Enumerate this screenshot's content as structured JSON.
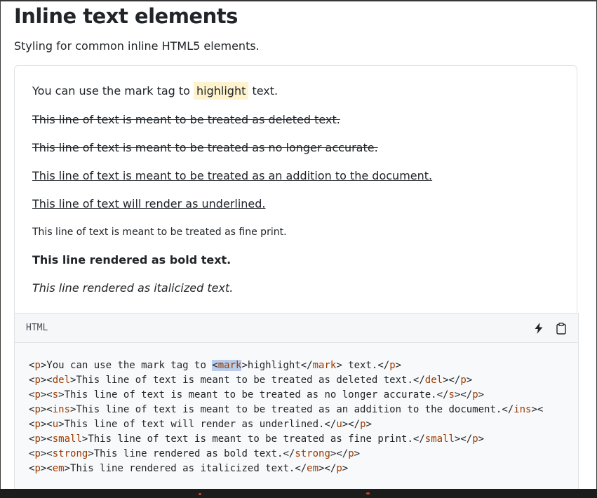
{
  "page": {
    "title": "Inline text elements",
    "subtitle": "Styling for common inline HTML5 elements."
  },
  "example": {
    "mark_before": "You can use the mark tag to ",
    "mark_text": "highlight",
    "mark_after": " text.",
    "del": "This line of text is meant to be treated as deleted text.",
    "s": "This line of text is meant to be treated as no longer accurate.",
    "ins": "This line of text is meant to be treated as an addition to the document.",
    "u": "This line of text will render as underlined.",
    "small": "This line of text is meant to be treated as fine print.",
    "strong": "This line rendered as bold text.",
    "em": "This line rendered as italicized text."
  },
  "code": {
    "language": "HTML",
    "icons": {
      "run": "lightning-icon",
      "copy": "clipboard-icon"
    },
    "lines": [
      [
        {
          "t": "<"
        },
        {
          "t": "p",
          "tag": 1
        },
        {
          "t": ">You can use the mark tag to "
        },
        {
          "t": "<mark",
          "sel": 1
        },
        {
          "t": ">highlight</"
        },
        {
          "t": "mark",
          "tag": 1
        },
        {
          "t": "> text.</"
        },
        {
          "t": "p",
          "tag": 1
        },
        {
          "t": ">"
        }
      ],
      [
        {
          "t": "<"
        },
        {
          "t": "p",
          "tag": 1
        },
        {
          "t": "><"
        },
        {
          "t": "del",
          "tag": 1
        },
        {
          "t": ">This line of text is meant to be treated as deleted text.</"
        },
        {
          "t": "del",
          "tag": 1
        },
        {
          "t": "></"
        },
        {
          "t": "p",
          "tag": 1
        },
        {
          "t": ">"
        }
      ],
      [
        {
          "t": "<"
        },
        {
          "t": "p",
          "tag": 1
        },
        {
          "t": "><"
        },
        {
          "t": "s",
          "tag": 1
        },
        {
          "t": ">This line of text is meant to be treated as no longer accurate.</"
        },
        {
          "t": "s",
          "tag": 1
        },
        {
          "t": "></"
        },
        {
          "t": "p",
          "tag": 1
        },
        {
          "t": ">"
        }
      ],
      [
        {
          "t": "<"
        },
        {
          "t": "p",
          "tag": 1
        },
        {
          "t": "><"
        },
        {
          "t": "ins",
          "tag": 1
        },
        {
          "t": ">This line of text is meant to be treated as an addition to the document.</"
        },
        {
          "t": "ins",
          "tag": 1
        },
        {
          "t": "><"
        }
      ],
      [
        {
          "t": "<"
        },
        {
          "t": "p",
          "tag": 1
        },
        {
          "t": "><"
        },
        {
          "t": "u",
          "tag": 1
        },
        {
          "t": ">This line of text will render as underlined.</"
        },
        {
          "t": "u",
          "tag": 1
        },
        {
          "t": "></"
        },
        {
          "t": "p",
          "tag": 1
        },
        {
          "t": ">"
        }
      ],
      [
        {
          "t": "<"
        },
        {
          "t": "p",
          "tag": 1
        },
        {
          "t": "><"
        },
        {
          "t": "small",
          "tag": 1
        },
        {
          "t": ">This line of text is meant to be treated as fine print.</"
        },
        {
          "t": "small",
          "tag": 1
        },
        {
          "t": "></"
        },
        {
          "t": "p",
          "tag": 1
        },
        {
          "t": ">"
        }
      ],
      [
        {
          "t": "<"
        },
        {
          "t": "p",
          "tag": 1
        },
        {
          "t": "><"
        },
        {
          "t": "strong",
          "tag": 1
        },
        {
          "t": ">This line rendered as bold text.</"
        },
        {
          "t": "strong",
          "tag": 1
        },
        {
          "t": "></"
        },
        {
          "t": "p",
          "tag": 1
        },
        {
          "t": ">"
        }
      ],
      [
        {
          "t": "<"
        },
        {
          "t": "p",
          "tag": 1
        },
        {
          "t": "><"
        },
        {
          "t": "em",
          "tag": 1
        },
        {
          "t": ">This line rendered as italicized text.</"
        },
        {
          "t": "em",
          "tag": 1
        },
        {
          "t": "></"
        },
        {
          "t": "p",
          "tag": 1
        },
        {
          "t": ">"
        }
      ]
    ]
  },
  "colors": {
    "tag": "#9a3a00",
    "mark_bg": "#fff3cd",
    "selection": "#b8cdec"
  }
}
